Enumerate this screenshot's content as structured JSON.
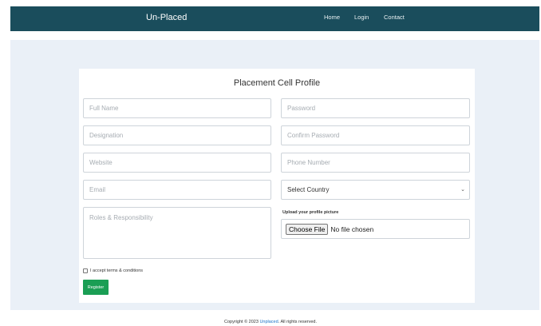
{
  "navbar": {
    "brand": "Un-Placed",
    "links": [
      "Home",
      "Login",
      "Contact"
    ],
    "background": "#1a4d5c"
  },
  "form": {
    "title": "Placement Cell Profile",
    "placeholders": {
      "full_name": "Full Name",
      "password": "Password",
      "designation": "Designation",
      "confirm_password": "Confirm Password",
      "website": "Website",
      "phone_number": "Phone Number",
      "email": "Email",
      "roles": "Roles & Responsibility"
    },
    "country_select": {
      "selected": "Select Country",
      "arrow_icon": "chevron-down-icon"
    },
    "upload": {
      "label": "Upload your profile picture",
      "button_label": "Choose File",
      "status": "No file chosen"
    },
    "terms_label": "I accept terms & conditions",
    "register_label": "Register",
    "accent_color": "#1a9e54"
  },
  "footer": {
    "prefix": "Copyright © 2023",
    "brand": "Unplaced",
    "suffix": ". All rights reserved.",
    "link_color": "#1a73c8"
  }
}
